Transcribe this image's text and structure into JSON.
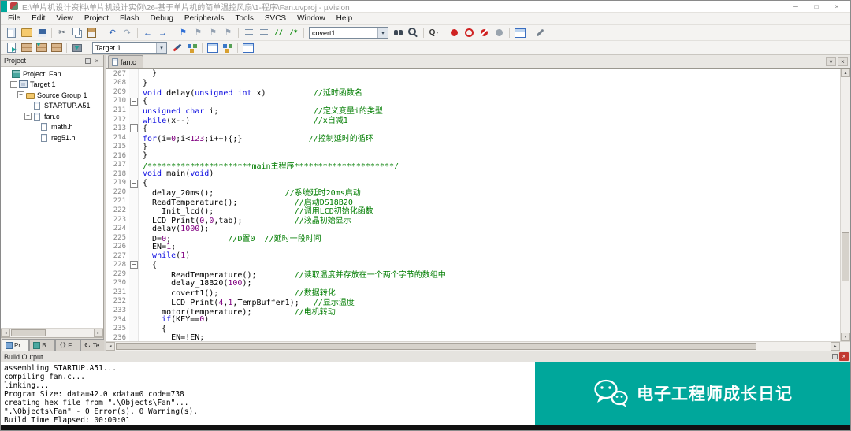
{
  "colors": {
    "teal": "#00a79b",
    "kw": "#0a0ae0",
    "cm": "#007d00",
    "num": "#800080"
  },
  "window": {
    "title": "E:\\单片机设计资料\\单片机设计实例\\26-基于单片机的简单温控风扇\\1-程序\\Fan.uvproj - µVision"
  },
  "menu": {
    "items": [
      "File",
      "Edit",
      "View",
      "Project",
      "Flash",
      "Debug",
      "Peripherals",
      "Tools",
      "SVCS",
      "Window",
      "Help"
    ]
  },
  "toolbar1": {
    "items": [
      {
        "type": "btn",
        "name": "new-file-icon",
        "icon": "doc"
      },
      {
        "type": "btn",
        "name": "open-file-icon",
        "icon": "folder"
      },
      {
        "type": "btn",
        "name": "save-icon",
        "icon": "save"
      },
      {
        "type": "sep"
      },
      {
        "type": "btn",
        "name": "cut-icon",
        "icon": "cut"
      },
      {
        "type": "btn",
        "name": "copy-icon",
        "icon": "copy"
      },
      {
        "type": "btn",
        "name": "paste-icon",
        "icon": "paste"
      },
      {
        "type": "sep"
      },
      {
        "type": "btn",
        "name": "undo-icon",
        "icon": "undo"
      },
      {
        "type": "btn",
        "name": "redo-icon",
        "icon": "redo"
      },
      {
        "type": "sep"
      },
      {
        "type": "btn",
        "name": "nav-back-icon",
        "icon": "back"
      },
      {
        "type": "btn",
        "name": "nav-forward-icon",
        "icon": "fwd"
      },
      {
        "type": "sep"
      },
      {
        "type": "btn",
        "name": "bookmark-toggle-icon",
        "icon": "flag"
      },
      {
        "type": "btn",
        "name": "bookmark-prev-icon",
        "icon": "flagg"
      },
      {
        "type": "btn",
        "name": "bookmark-next-icon",
        "icon": "flagg"
      },
      {
        "type": "btn",
        "name": "bookmark-clear-icon",
        "icon": "flagg"
      },
      {
        "type": "sep"
      },
      {
        "type": "btn",
        "name": "unindent-icon",
        "icon": "ind"
      },
      {
        "type": "btn",
        "name": "indent-icon",
        "icon": "ind"
      },
      {
        "type": "btn",
        "name": "comment-selection-icon",
        "icon": "cmt"
      },
      {
        "type": "btn",
        "name": "uncomment-selection-icon",
        "icon": "ucmt"
      },
      {
        "type": "sep"
      },
      {
        "type": "combo",
        "name": "find-combo",
        "value": "covert1",
        "width": 86
      },
      {
        "type": "btn",
        "name": "find-in-files-icon",
        "icon": "binoc"
      },
      {
        "type": "btn",
        "name": "search-icon",
        "icon": "mag"
      },
      {
        "type": "sep"
      },
      {
        "type": "btn",
        "name": "quick-find-icon",
        "icon": "q"
      },
      {
        "type": "sep"
      },
      {
        "type": "btn",
        "name": "insert-breakpoint-icon",
        "icon": "bp"
      },
      {
        "type": "btn",
        "name": "disable-breakpoint-icon",
        "icon": "bpo"
      },
      {
        "type": "btn",
        "name": "kill-breakpoints-icon",
        "icon": "bpx"
      },
      {
        "type": "btn",
        "name": "enable-breakpoints-icon",
        "icon": "bpg"
      },
      {
        "type": "sep"
      },
      {
        "type": "btn",
        "name": "window-layout-icon",
        "icon": "winlay"
      },
      {
        "type": "sep"
      },
      {
        "type": "btn",
        "name": "configure-icon",
        "icon": "wrench"
      }
    ]
  },
  "toolbar2": {
    "items": [
      {
        "type": "btn",
        "name": "translate-file-icon",
        "icon": "translate"
      },
      {
        "type": "btn",
        "name": "build-icon",
        "icon": "bricks"
      },
      {
        "type": "btn",
        "name": "rebuild-all-icon",
        "icon": "bricks2"
      },
      {
        "type": "btn",
        "name": "batch-build-icon",
        "icon": "bricks"
      },
      {
        "type": "sep"
      },
      {
        "type": "btn",
        "name": "download-flash-icon",
        "icon": "download"
      },
      {
        "type": "sep"
      },
      {
        "type": "combo",
        "name": "target-combo",
        "value": "Target 1",
        "width": 80
      },
      {
        "type": "btn",
        "name": "options-for-target-icon",
        "icon": "wand"
      },
      {
        "type": "btn",
        "name": "manage-project-items-icon",
        "icon": "boxes"
      },
      {
        "type": "sep"
      },
      {
        "type": "btn",
        "name": "file-extensions-icon",
        "icon": "winlay"
      },
      {
        "type": "btn",
        "name": "multi-project-icon",
        "icon": "boxes"
      },
      {
        "type": "sep"
      },
      {
        "type": "btn",
        "name": "debug-windows-icon",
        "icon": "winlay"
      }
    ]
  },
  "project_panel": {
    "title": "Project",
    "tree": [
      {
        "label": "Project: Fan",
        "level": 0,
        "exp": false,
        "icon": "workspace"
      },
      {
        "label": "Target 1",
        "level": 1,
        "exp": true,
        "icon": "target"
      },
      {
        "label": "Source Group 1",
        "level": 2,
        "exp": true,
        "icon": "folder"
      },
      {
        "label": "STARTUP.A51",
        "level": 3,
        "exp": false,
        "icon": "file"
      },
      {
        "label": "fan.c",
        "level": 3,
        "exp": true,
        "icon": "file"
      },
      {
        "label": "math.h",
        "level": 4,
        "exp": false,
        "icon": "file"
      },
      {
        "label": "reg51.h",
        "level": 4,
        "exp": false,
        "icon": "file"
      }
    ],
    "tabs": [
      {
        "label": "Pr...",
        "icon": "proj",
        "name": "panel-tab-project"
      },
      {
        "label": "B...",
        "icon": "book",
        "name": "panel-tab-books"
      },
      {
        "label": "F...",
        "icon": "func",
        "name": "panel-tab-functions"
      },
      {
        "label": "Te...",
        "icon": "tmpl",
        "name": "panel-tab-templates"
      }
    ]
  },
  "editor": {
    "tab_label": "fan.c",
    "lines": [
      {
        "n": 207,
        "fold": false,
        "parts": [
          [
            "  }",
            "pl"
          ]
        ]
      },
      {
        "n": 208,
        "fold": false,
        "parts": [
          [
            "}",
            "pl"
          ]
        ]
      },
      {
        "n": 209,
        "fold": false,
        "parts": [
          [
            "void",
            "kw"
          ],
          [
            " delay(",
            "pl"
          ],
          [
            "unsigned",
            "kw"
          ],
          [
            " ",
            "pl"
          ],
          [
            "int",
            "kw"
          ],
          [
            " x)          ",
            "pl"
          ],
          [
            "//延时函数名",
            "cm"
          ]
        ]
      },
      {
        "n": 210,
        "fold": true,
        "parts": [
          [
            "{",
            "pl"
          ]
        ]
      },
      {
        "n": 211,
        "fold": false,
        "parts": [
          [
            "unsigned",
            "kw"
          ],
          [
            " ",
            "pl"
          ],
          [
            "char",
            "kw"
          ],
          [
            " i;                    ",
            "pl"
          ],
          [
            "//定义变量i的类型",
            "cm"
          ]
        ]
      },
      {
        "n": 212,
        "fold": false,
        "parts": [
          [
            "while",
            "kw"
          ],
          [
            "(x--)                          ",
            "pl"
          ],
          [
            "//x自减1",
            "cm"
          ]
        ]
      },
      {
        "n": 213,
        "fold": true,
        "parts": [
          [
            "{",
            "pl"
          ]
        ]
      },
      {
        "n": 214,
        "fold": false,
        "parts": [
          [
            "for",
            "kw"
          ],
          [
            "(i=",
            "pl"
          ],
          [
            "0",
            "num"
          ],
          [
            ";i<",
            "pl"
          ],
          [
            "123",
            "num"
          ],
          [
            ";i++){;}              ",
            "pl"
          ],
          [
            "//控制延时的循环",
            "cm"
          ]
        ]
      },
      {
        "n": 215,
        "fold": false,
        "parts": [
          [
            "}",
            "pl"
          ]
        ]
      },
      {
        "n": 216,
        "fold": false,
        "parts": [
          [
            "}",
            "pl"
          ]
        ]
      },
      {
        "n": 217,
        "fold": false,
        "parts": [
          [
            "/**********************main主程序*********************/",
            "cm"
          ]
        ]
      },
      {
        "n": 218,
        "fold": false,
        "parts": [
          [
            "void",
            "kw"
          ],
          [
            " main(",
            "pl"
          ],
          [
            "void",
            "kw"
          ],
          [
            ")",
            "pl"
          ]
        ]
      },
      {
        "n": 219,
        "fold": true,
        "parts": [
          [
            "{",
            "pl"
          ]
        ]
      },
      {
        "n": 220,
        "fold": false,
        "parts": [
          [
            "  delay_20ms();               ",
            "pl"
          ],
          [
            "//系统延时20ms启动",
            "cm"
          ]
        ]
      },
      {
        "n": 221,
        "fold": false,
        "parts": [
          [
            "  ReadTemperature();            ",
            "pl"
          ],
          [
            "//启动DS18B20",
            "cm"
          ]
        ]
      },
      {
        "n": 222,
        "fold": false,
        "parts": [
          [
            "    Init_lcd();                 ",
            "pl"
          ],
          [
            "//调用LCD初始化函数",
            "cm"
          ]
        ]
      },
      {
        "n": 223,
        "fold": false,
        "parts": [
          [
            "  LCD_Print(",
            "pl"
          ],
          [
            "0",
            "num"
          ],
          [
            ",",
            "pl"
          ],
          [
            "0",
            "num"
          ],
          [
            ",tab);           ",
            "pl"
          ],
          [
            "//液晶初始显示",
            "cm"
          ]
        ]
      },
      {
        "n": 224,
        "fold": false,
        "parts": [
          [
            "  delay(",
            "pl"
          ],
          [
            "1000",
            "num"
          ],
          [
            ");",
            "pl"
          ]
        ]
      },
      {
        "n": 225,
        "fold": false,
        "parts": [
          [
            "  D=",
            "pl"
          ],
          [
            "0",
            "num"
          ],
          [
            ";            ",
            "pl"
          ],
          [
            "//D置0",
            "cm"
          ],
          [
            "  ",
            "pl"
          ],
          [
            "//延时一段时间",
            "cm"
          ]
        ]
      },
      {
        "n": 226,
        "fold": false,
        "parts": [
          [
            "  EN=",
            "pl"
          ],
          [
            "1",
            "num"
          ],
          [
            ";",
            "pl"
          ]
        ]
      },
      {
        "n": 227,
        "fold": false,
        "parts": [
          [
            "  ",
            "pl"
          ],
          [
            "while",
            "kw"
          ],
          [
            "(",
            "pl"
          ],
          [
            "1",
            "num"
          ],
          [
            ")",
            "pl"
          ]
        ]
      },
      {
        "n": 228,
        "fold": true,
        "parts": [
          [
            "  {",
            "pl"
          ]
        ]
      },
      {
        "n": 229,
        "fold": false,
        "parts": [
          [
            "      ReadTemperature();        ",
            "pl"
          ],
          [
            "//读取温度并存放在一个两个字节的数组中",
            "cm"
          ]
        ]
      },
      {
        "n": 230,
        "fold": false,
        "parts": [
          [
            "      delay_18B20(",
            "pl"
          ],
          [
            "100",
            "num"
          ],
          [
            ");",
            "pl"
          ]
        ]
      },
      {
        "n": 231,
        "fold": false,
        "parts": [
          [
            "      covert1();                ",
            "pl"
          ],
          [
            "//数据转化",
            "cm"
          ]
        ]
      },
      {
        "n": 232,
        "fold": false,
        "parts": [
          [
            "      LCD_Print(",
            "pl"
          ],
          [
            "4",
            "num"
          ],
          [
            ",",
            "pl"
          ],
          [
            "1",
            "num"
          ],
          [
            ",TempBuffer1);   ",
            "pl"
          ],
          [
            "//显示温度",
            "cm"
          ]
        ]
      },
      {
        "n": 233,
        "fold": false,
        "parts": [
          [
            "    motor(temperature);         ",
            "pl"
          ],
          [
            "//电机转动",
            "cm"
          ]
        ]
      },
      {
        "n": 234,
        "fold": false,
        "parts": [
          [
            "    ",
            "pl"
          ],
          [
            "if",
            "kw"
          ],
          [
            "(KEY==",
            "pl"
          ],
          [
            "0",
            "num"
          ],
          [
            ")",
            "pl"
          ]
        ]
      },
      {
        "n": 235,
        "fold": false,
        "parts": [
          [
            "    {",
            "pl"
          ]
        ]
      },
      {
        "n": 236,
        "fold": false,
        "parts": [
          [
            "      EN=!EN;",
            "pl"
          ]
        ]
      }
    ]
  },
  "build_output": {
    "title": "Build Output",
    "lines": [
      "assembling STARTUP.A51...",
      "compiling fan.c...",
      "linking...",
      "Program Size: data=42.0 xdata=0 code=738",
      "creating hex file from \".\\Objects\\Fan\"...",
      "\".\\Objects\\Fan\" - 0 Error(s), 0 Warning(s).",
      "Build Time Elapsed:  00:00:01"
    ]
  },
  "watermark": {
    "text": "电子工程师成长日记"
  }
}
